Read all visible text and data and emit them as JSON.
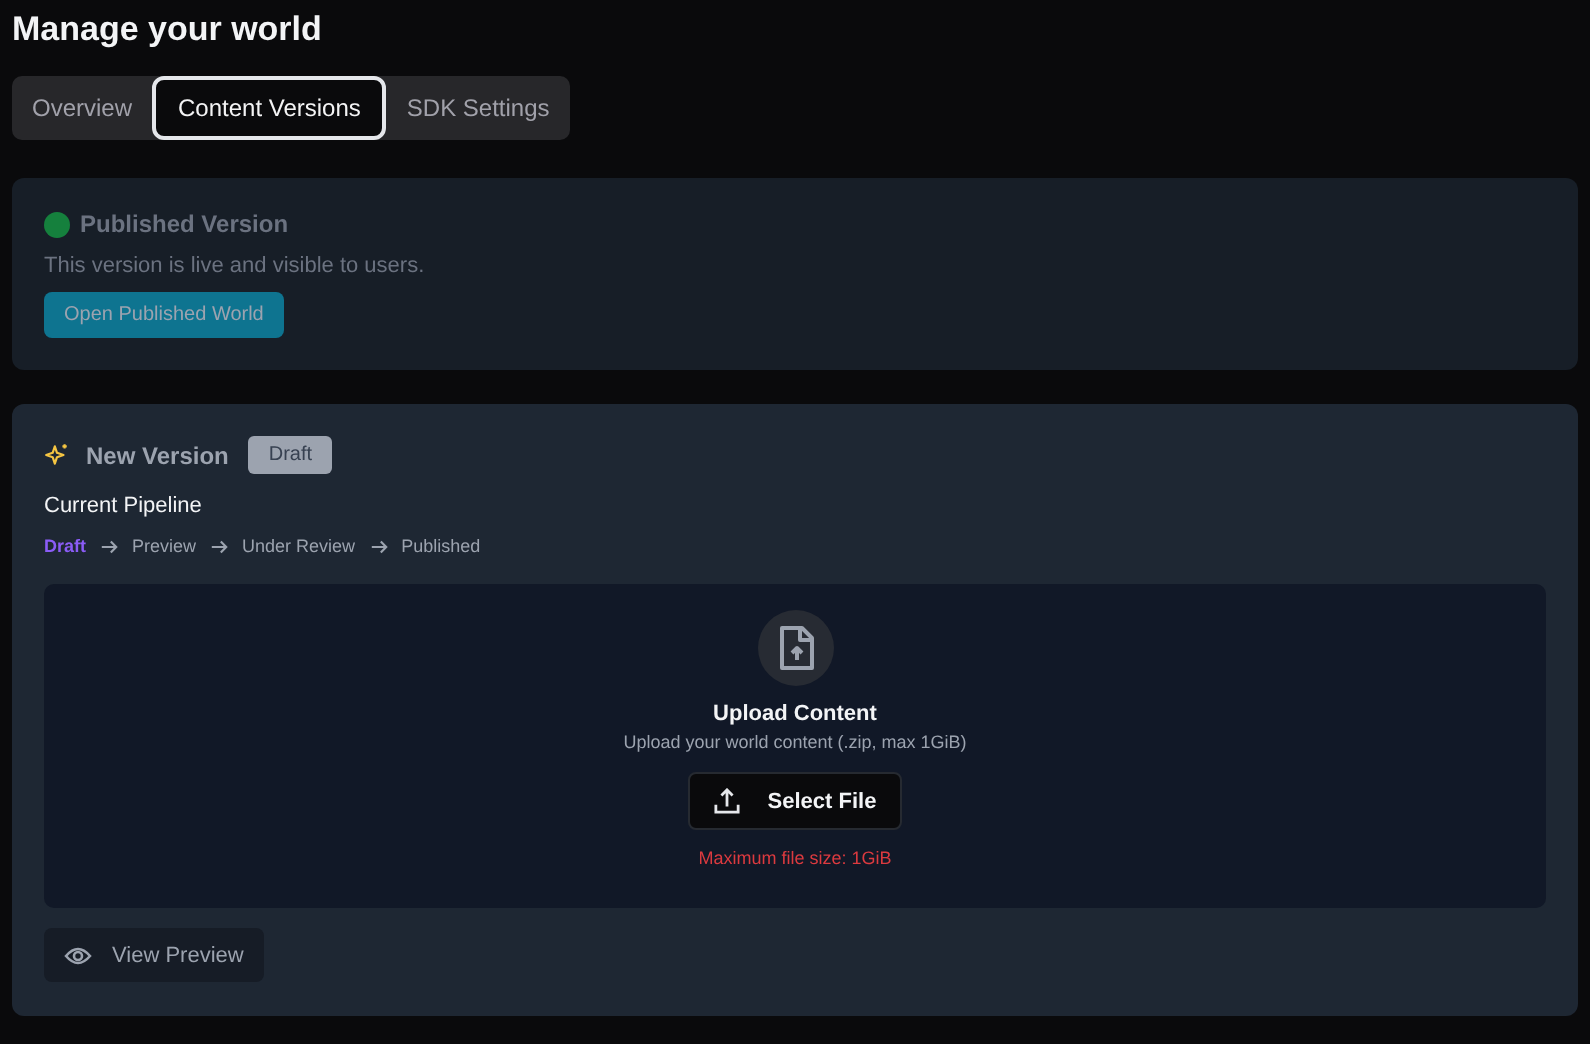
{
  "title": "Manage your world",
  "tabs": [
    {
      "label": "Overview",
      "selected": false
    },
    {
      "label": "Content Versions",
      "selected": true
    },
    {
      "label": "SDK Settings",
      "selected": false
    }
  ],
  "published": {
    "title": "Published Version",
    "description": "This version is live and visible to users.",
    "button": "Open Published World"
  },
  "new_version": {
    "title": "New Version",
    "badge": "Draft",
    "pipeline_title": "Current Pipeline",
    "pipeline": [
      {
        "label": "Draft",
        "selected": true
      },
      {
        "label": "Preview",
        "selected": false
      },
      {
        "label": "Under Review",
        "selected": false
      },
      {
        "label": "Published",
        "selected": false
      }
    ],
    "upload": {
      "title": "Upload Content",
      "subtitle": "Upload your world content (.zip, max 1GiB)",
      "button": "Select File",
      "warning": "Maximum file size: 1GiB"
    },
    "preview_button": "View Preview"
  }
}
